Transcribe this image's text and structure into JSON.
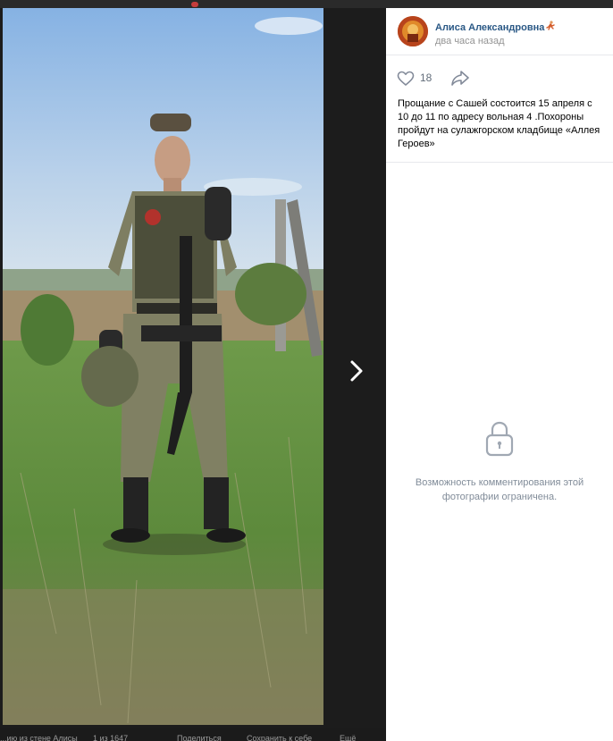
{
  "post": {
    "author": "Алиса Александровна",
    "time": "два часа назад",
    "likes": "18",
    "caption": "Прощание с Сашей состоится 15 апреля с 10 до 11 по адресу вольная 4 .Похороны пройдут на сулажгорском кладбище «Аллея Героев»"
  },
  "comments": {
    "locked_text": "Возможность комментирования этой фотографии ограничена."
  },
  "bottom_bar": {
    "items": [
      "...ию из стене Алисы",
      "1 из 1647",
      "Поделиться",
      "Сохранить к себе",
      "Ещё"
    ]
  },
  "icons": {
    "like": "heart-icon",
    "share": "share-icon",
    "next": "chevron-right-icon",
    "lock": "lock-icon"
  },
  "colors": {
    "author_link": "#2a5885",
    "secondary_text": "#939393",
    "locked_text": "#818c99",
    "viewer_bg": "#1c1c1c"
  }
}
